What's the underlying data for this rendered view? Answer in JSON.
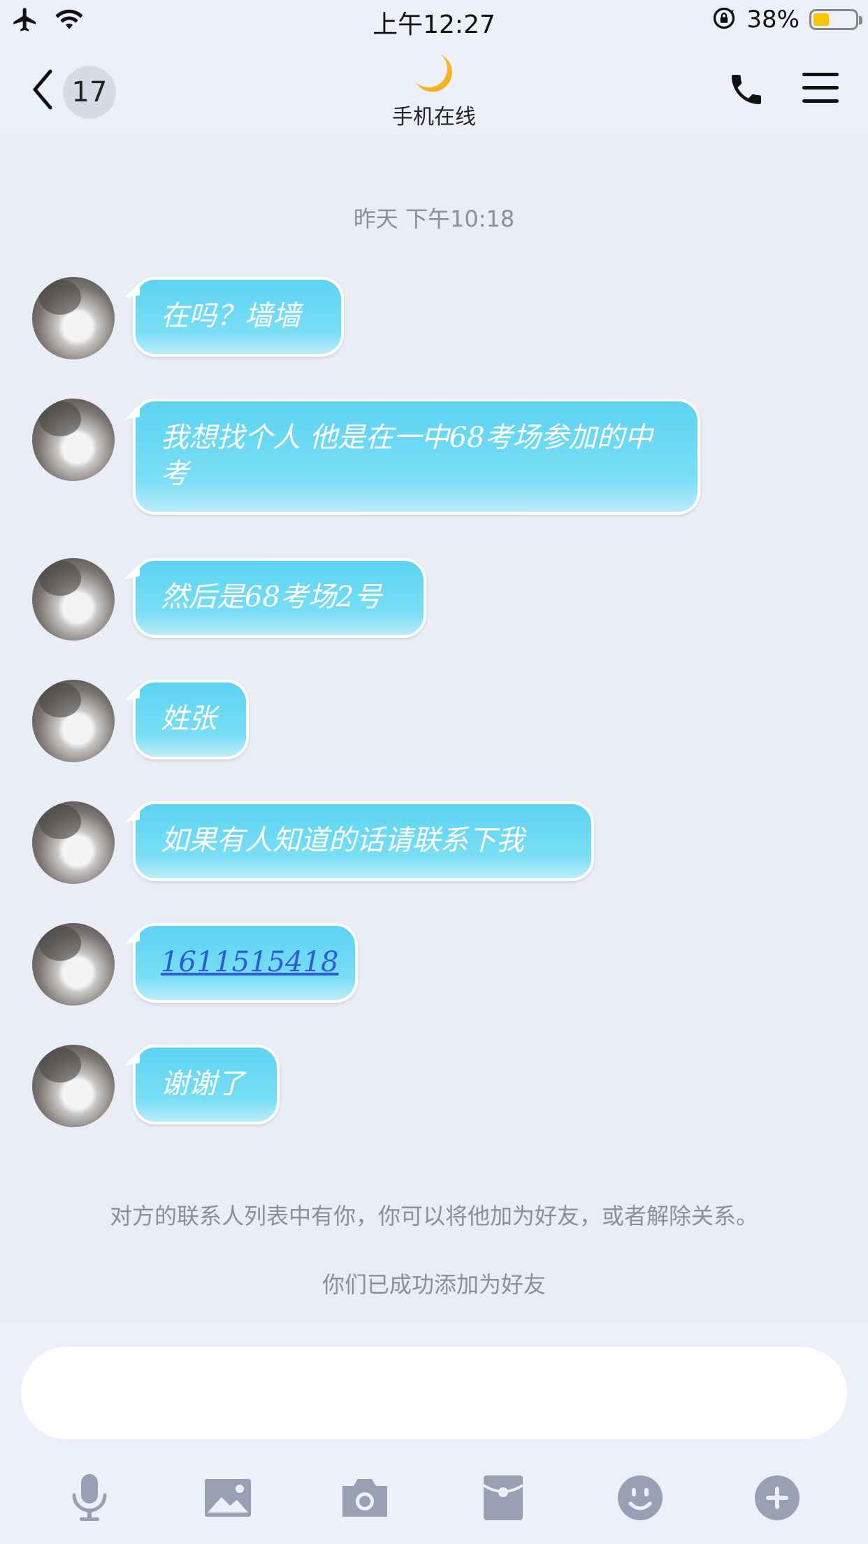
{
  "status_bar": {
    "time": "上午12:27",
    "battery_percent": "38%",
    "battery_level": 0.38,
    "icons": [
      "airplane-icon",
      "wifi-icon",
      "rotation-lock-icon",
      "battery-icon"
    ]
  },
  "header": {
    "unread_count": "17",
    "status_text": "手机在线",
    "status_icon": "moon-icon"
  },
  "chat": {
    "timestamp": "昨天 下午10:18",
    "messages": [
      {
        "text": "在吗？墙墙"
      },
      {
        "text": "我想找个人 他是在一中68考场参加的中考"
      },
      {
        "text": "然后是68考场2号"
      },
      {
        "text": "姓张"
      },
      {
        "text": "如果有人知道的话请联系下我"
      },
      {
        "text": "1611515418",
        "is_link": true
      },
      {
        "text": "谢谢了"
      }
    ],
    "system_notice": "对方的联系人列表中有你，你可以将他加为好友，或者解除关系。",
    "friend_added_notice": "你们已成功添加为好友"
  },
  "input": {
    "value": "",
    "placeholder": ""
  },
  "toolbar": {
    "icons": [
      "microphone-icon",
      "image-icon",
      "camera-icon",
      "red-packet-icon",
      "emoji-icon",
      "plus-icon"
    ]
  },
  "colors": {
    "bubble": "#5cd3f2",
    "link": "#2d5bd6",
    "background": "#eaedf6",
    "battery": "#f7c600"
  }
}
